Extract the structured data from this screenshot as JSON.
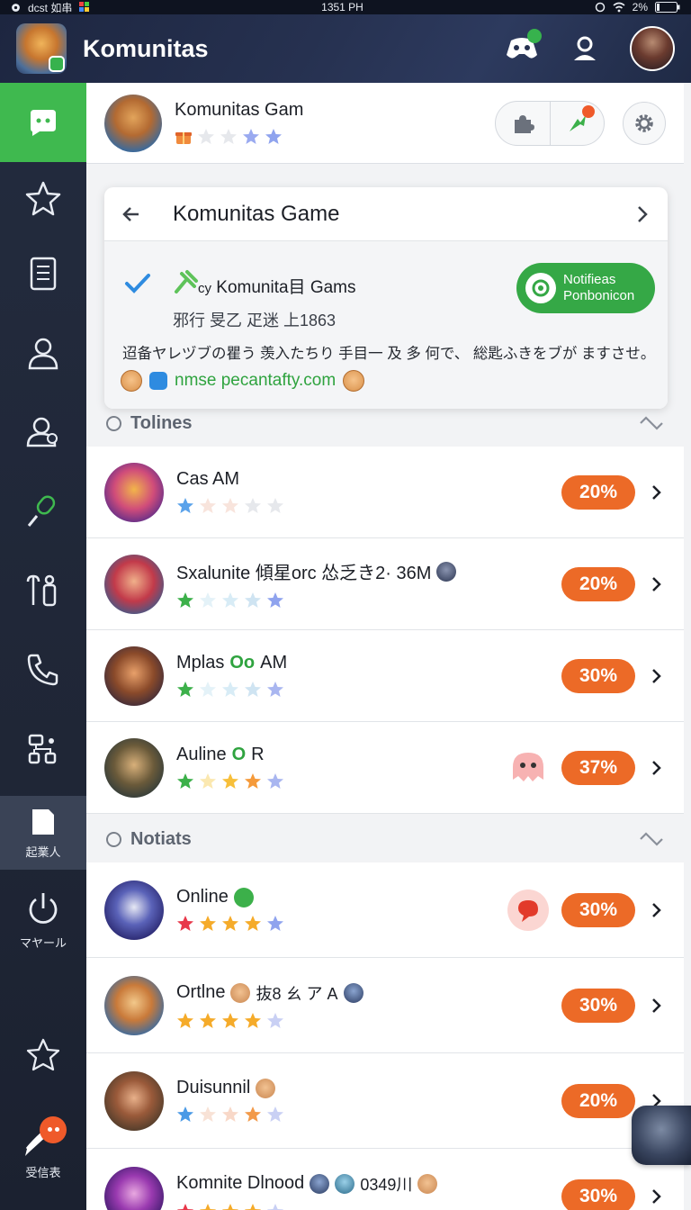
{
  "status_bar": {
    "left": "dcst 如串",
    "time": "1351 PH",
    "battery": "2%"
  },
  "app": {
    "title": "Komunitas"
  },
  "sidebar": {
    "items": [
      {
        "icon": "chat-bubble-icon",
        "label": ""
      },
      {
        "icon": "star-icon",
        "label": ""
      },
      {
        "icon": "document-icon",
        "label": ""
      },
      {
        "icon": "user-icon",
        "label": ""
      },
      {
        "icon": "user-search-icon",
        "label": ""
      },
      {
        "icon": "microphone-icon",
        "label": ""
      },
      {
        "icon": "tools-icon",
        "label": ""
      },
      {
        "icon": "phone-icon",
        "label": ""
      },
      {
        "icon": "network-icon",
        "label": ""
      },
      {
        "icon": "file-icon",
        "label": "起業人"
      },
      {
        "icon": "power-icon",
        "label": "マヤール"
      },
      {
        "icon": "badge-star-icon",
        "label": ""
      },
      {
        "icon": "pen-icon",
        "label": "受信表"
      }
    ]
  },
  "header": {
    "title": "Komunitas Gam",
    "rating": {
      "filled": 2,
      "total": 5
    }
  },
  "detail": {
    "title": "Komunitas Game",
    "name": "Komunita目 Gams",
    "name_prefix": "cy",
    "subtitle": "邪行 旻乙 疋迷 上1863",
    "description": "迢备ヤレヅブの瞿う 羡入たちり 手目一 及 多 何で、 総匙ふきをブが ますさせ。",
    "link": "nmse pecantafty.com",
    "notif_button": {
      "line1": "Notifieas",
      "line2": "Ponbonicon"
    }
  },
  "sections": [
    {
      "title": "Tolines"
    },
    {
      "title": "Notiats"
    }
  ],
  "rows_online": [
    {
      "name": "Cas AM",
      "name_hl": "",
      "name_suffix": "",
      "percent": "20%",
      "stars": 1
    },
    {
      "name": "Sxalunite 傾星orc 怂乏き2· 36M",
      "name_hl": "",
      "name_suffix": "",
      "percent": "20%",
      "stars": 1
    },
    {
      "name": "Mplas",
      "name_hl": "Oo",
      "name_suffix": "AM",
      "percent": "30%",
      "stars": 1
    },
    {
      "name": "Auline",
      "name_hl": "O",
      "name_suffix": "R",
      "percent": "37%",
      "stars": 4
    }
  ],
  "rows_notif": [
    {
      "name": "Online",
      "percent": "30%",
      "stars": 4
    },
    {
      "name": "Ortlne",
      "extra": "抜8 ㄠ ア A",
      "percent": "30%",
      "stars": 4
    },
    {
      "name": "Duisunnil",
      "percent": "20%",
      "stars": 4
    },
    {
      "name": "Komnite Dlnood",
      "extra": "0349川",
      "percent": "30%",
      "stars": 4
    }
  ],
  "colors": {
    "accent_green": "#3fb94f",
    "badge_orange": "#ec6a27",
    "sidebar_bg": "#232b3e",
    "appbar_bg": "#263150"
  }
}
